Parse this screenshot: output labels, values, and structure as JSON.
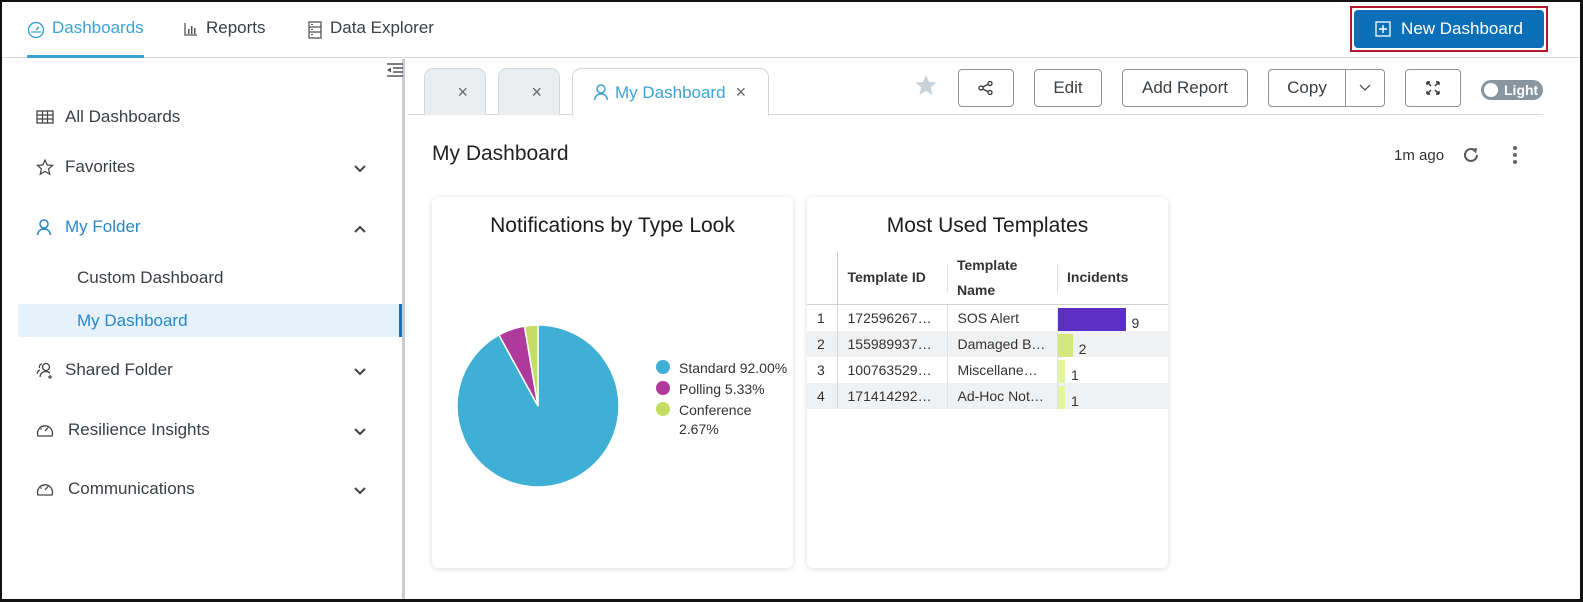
{
  "topnav": {
    "tabs": [
      {
        "label": "Dashboards",
        "icon": "gauge-icon",
        "active": true
      },
      {
        "label": "Reports",
        "icon": "bar-chart-icon",
        "active": false
      },
      {
        "label": "Data Explorer",
        "icon": "database-icon",
        "active": false
      }
    ],
    "new_dashboard_label": "New Dashboard"
  },
  "sidebar": {
    "items": [
      {
        "label": "All Dashboards",
        "icon": "grid-icon"
      },
      {
        "label": "Favorites",
        "icon": "star-outline-icon",
        "expanded": false
      },
      {
        "label": "My Folder",
        "icon": "user-icon",
        "expanded": true
      },
      {
        "label": "Shared Folder",
        "icon": "shared-users-icon",
        "expanded": false
      },
      {
        "label": "Resilience Insights",
        "icon": "gauge-icon",
        "expanded": false
      },
      {
        "label": "Communications",
        "icon": "gauge-icon",
        "expanded": false
      }
    ],
    "my_folder_children": [
      {
        "label": "Custom Dashboard",
        "active": false
      },
      {
        "label": "My Dashboard",
        "active": true
      }
    ]
  },
  "tabs": {
    "items": [
      {
        "label": "",
        "active": false
      },
      {
        "label": "",
        "active": false
      },
      {
        "label": "My Dashboard",
        "active": true
      }
    ],
    "close_glyph": "×"
  },
  "toolbar": {
    "edit_label": "Edit",
    "add_report_label": "Add Report",
    "copy_label": "Copy",
    "theme_toggle_label": "Light"
  },
  "dashboard": {
    "title": "My Dashboard",
    "updated": "1m ago"
  },
  "widgets": {
    "pie": {
      "title": "Notifications by Type Look"
    },
    "table": {
      "title": "Most Used Templates",
      "columns": [
        "Template ID",
        "Template Name",
        "Incidents"
      ],
      "rows": [
        {
          "n": "1",
          "id": "172596267…",
          "name": "SOS Alert",
          "incidents": 9,
          "color": "#5a2fc2"
        },
        {
          "n": "2",
          "id": "155989937…",
          "name": "Damaged B…",
          "incidents": 2,
          "color": "#d4e77a"
        },
        {
          "n": "3",
          "id": "100763529…",
          "name": "Miscellane…",
          "incidents": 1,
          "color": "#e5f59a"
        },
        {
          "n": "4",
          "id": "171414292…",
          "name": "Ad-Hoc Not…",
          "incidents": 1,
          "color": "#e5f59a"
        }
      ]
    }
  },
  "chart_data": {
    "type": "pie",
    "title": "Notifications by Type Look",
    "legend_position": "right",
    "slices": [
      {
        "label": "Standard",
        "value": 92.0,
        "display": "92.00%",
        "color": "#3fafd6"
      },
      {
        "label": "Polling",
        "value": 5.33,
        "display": "5.33%",
        "color": "#b0399c"
      },
      {
        "label": "Conference",
        "value": 2.67,
        "display": "2.67%",
        "color": "#c5dc64"
      }
    ]
  }
}
